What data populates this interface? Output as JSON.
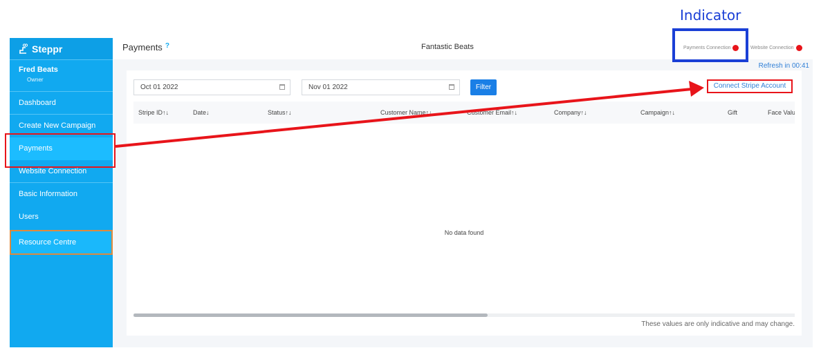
{
  "annotation": {
    "indicator_label": "Indicator"
  },
  "brand": {
    "name": "Steppr"
  },
  "user": {
    "name": "Fred Beats",
    "role": "Owner"
  },
  "sidebar": {
    "items": [
      {
        "label": "Dashboard"
      },
      {
        "label": "Create New Campaign"
      },
      {
        "label": "Payments",
        "active": true
      },
      {
        "label": "Website Connection"
      },
      {
        "label": "Basic Information"
      },
      {
        "label": "Users"
      },
      {
        "label": "Resource Centre"
      }
    ]
  },
  "header": {
    "title": "Payments",
    "help": "?",
    "org_name": "Fantastic Beats",
    "payments_connection": "Payments Connection",
    "website_connection": "Website Connection"
  },
  "content": {
    "refresh": "Refresh in 00:41",
    "date_from": "Oct 01 2022",
    "date_to": "Nov 01 2022",
    "filter_label": "Filter",
    "connect_stripe": "Connect Stripe Account",
    "columns": [
      "Stripe ID↑↓",
      "Date↓",
      "Status↑↓",
      "Customer Name↑↓",
      "Customer Email↑↓",
      "Company↑↓",
      "Campaign↑↓",
      "Gift",
      "Face Valu"
    ],
    "empty_message": "No data found",
    "note": "These values are only indicative and may change."
  },
  "colors": {
    "sidebar": "#11a9f0",
    "accent": "#1a7fe6",
    "status_red": "#e8141a",
    "annotation_blue": "#1a3fd6"
  }
}
